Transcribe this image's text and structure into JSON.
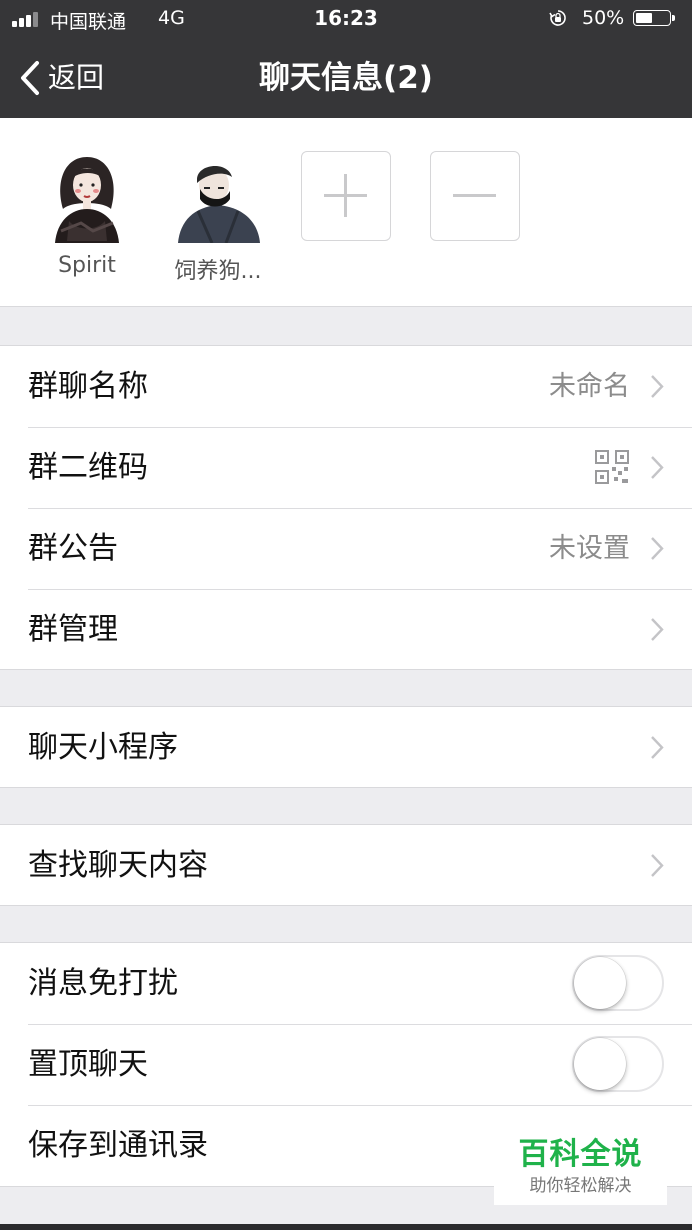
{
  "status_bar": {
    "carrier": "中国联通",
    "network": "4G",
    "time": "16:23",
    "battery_percent_label": "50%",
    "battery_level": 0.5
  },
  "nav": {
    "back_label": "返回",
    "title": "聊天信息(2)"
  },
  "members": [
    {
      "name": "Spirit",
      "avatar_icon": "woman-avatar-icon"
    },
    {
      "name": "饲养狗...",
      "avatar_icon": "masked-man-avatar-icon"
    }
  ],
  "member_actions": {
    "add_icon": "plus-icon",
    "remove_icon": "minus-icon"
  },
  "group_settings": {
    "name_label": "群聊名称",
    "name_value": "未命名",
    "qrcode_label": "群二维码",
    "notice_label": "群公告",
    "notice_value": "未设置",
    "manage_label": "群管理"
  },
  "mini_program": {
    "label": "聊天小程序"
  },
  "search": {
    "label": "查找聊天内容"
  },
  "toggles": {
    "mute_label": "消息免打扰",
    "mute_on": false,
    "pin_label": "置顶聊天",
    "pin_on": false,
    "save_contacts_label": "保存到通讯录"
  },
  "watermark": {
    "title": "百科全说",
    "subtitle": "助你轻松解决"
  },
  "colors": {
    "nav_background": "#363638",
    "page_background": "#ededf0",
    "watermark_green": "#1fb24a"
  }
}
